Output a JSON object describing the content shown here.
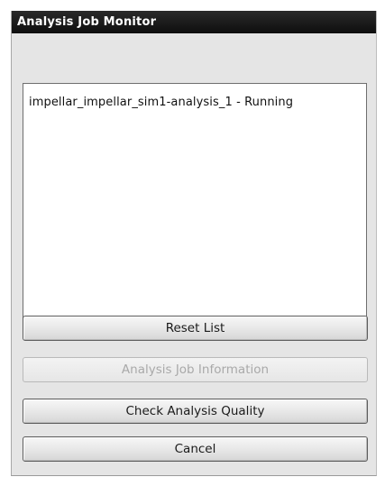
{
  "window": {
    "title": "Analysis Job Monitor"
  },
  "job_list": {
    "items": [
      "impellar_impellar_sim1-analysis_1 - Running"
    ]
  },
  "buttons": {
    "reset_list": "Reset List",
    "job_information": "Analysis Job Information",
    "check_quality": "Check Analysis Quality",
    "cancel": "Cancel"
  },
  "state": {
    "job_information_enabled": false
  }
}
